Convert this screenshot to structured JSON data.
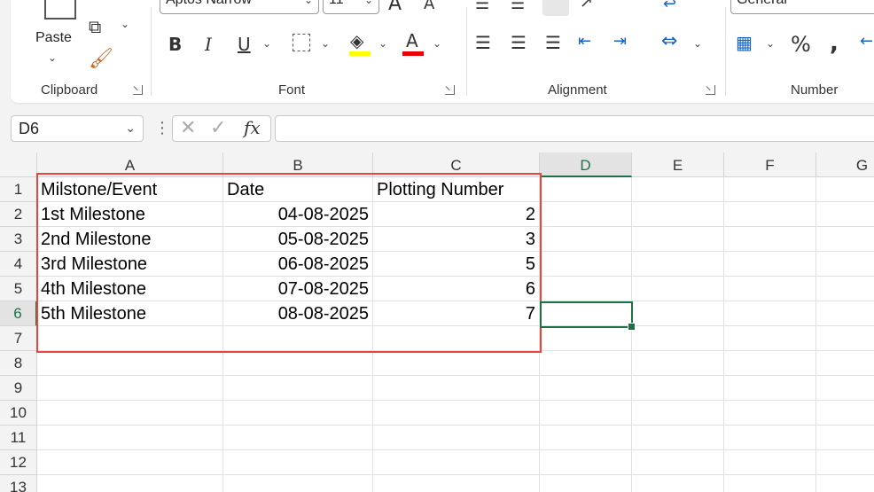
{
  "ribbon": {
    "font_name": "Aptos Narrow",
    "font_size": "11",
    "number_format": "General",
    "paste_label": "Paste",
    "groups": {
      "clipboard": "Clipboard",
      "font": "Font",
      "alignment": "Alignment",
      "number": "Number"
    },
    "icons": {
      "bold": "B",
      "italic": "I",
      "underline": "U",
      "font_color_letter": "A",
      "increase_font": "A",
      "decrease_font": "A",
      "percent": "%",
      "comma": "❞"
    },
    "colors": {
      "highlight_fill": "#ffff00",
      "font_color": "#e60000"
    }
  },
  "formula_bar": {
    "name_box": "D6",
    "fx": "fx",
    "formula": ""
  },
  "sheet": {
    "columns": [
      "A",
      "B",
      "C",
      "D",
      "E",
      "F",
      "G"
    ],
    "selected_column": "D",
    "rows": [
      "1",
      "2",
      "3",
      "4",
      "5",
      "6",
      "7",
      "8",
      "9",
      "10",
      "11",
      "12",
      "13"
    ],
    "selected_row": "6",
    "cells": [
      [
        "Milstone/Event",
        "Date",
        "Plotting Number"
      ],
      [
        "1st Milestone",
        "04-08-2025",
        "2"
      ],
      [
        "2nd Milestone",
        "05-08-2025",
        "3"
      ],
      [
        "3rd Milestone",
        "06-08-2025",
        "5"
      ],
      [
        "4th Milestone",
        "07-08-2025",
        "6"
      ],
      [
        "5th Milestone",
        "08-08-2025",
        "7"
      ]
    ],
    "active_cell": "D6",
    "accent_color": "#1e7145",
    "annotation_color": "#e8453c"
  }
}
